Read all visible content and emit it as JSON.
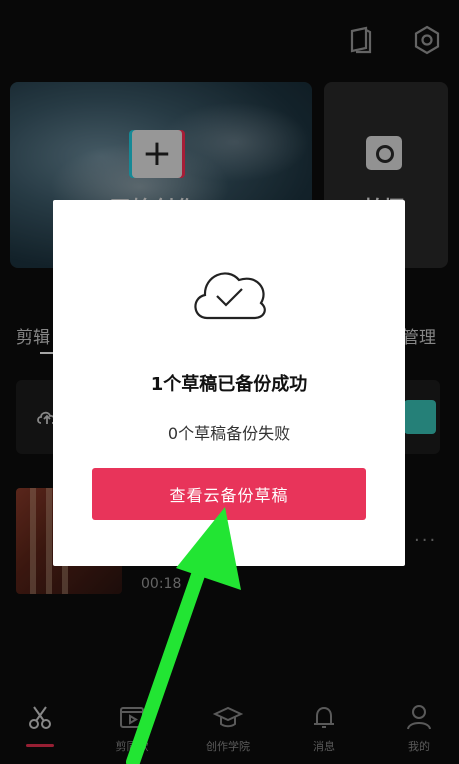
{
  "home": {
    "create_label": "开始创作",
    "shoot_label": "拍摄",
    "section_left": "剪辑",
    "section_right": "管理",
    "draft_time": "00:18",
    "draft_more": "···"
  },
  "dialog": {
    "title": "1个草稿已备份成功",
    "subtitle": "0个草稿备份失败",
    "button_label": "查看云备份草稿"
  },
  "bottom_nav": [
    {
      "label": "",
      "icon": "scissors-icon"
    },
    {
      "label": "剪同款",
      "icon": "video-template-icon"
    },
    {
      "label": "创作学院",
      "icon": "graduation-cap-icon"
    },
    {
      "label": "消息",
      "icon": "bell-icon"
    },
    {
      "label": "我的",
      "icon": "user-icon"
    }
  ],
  "colors": {
    "accent": "#e8345a",
    "annotation_arrow": "#22e533",
    "dialog_bg": "#ffffff"
  }
}
